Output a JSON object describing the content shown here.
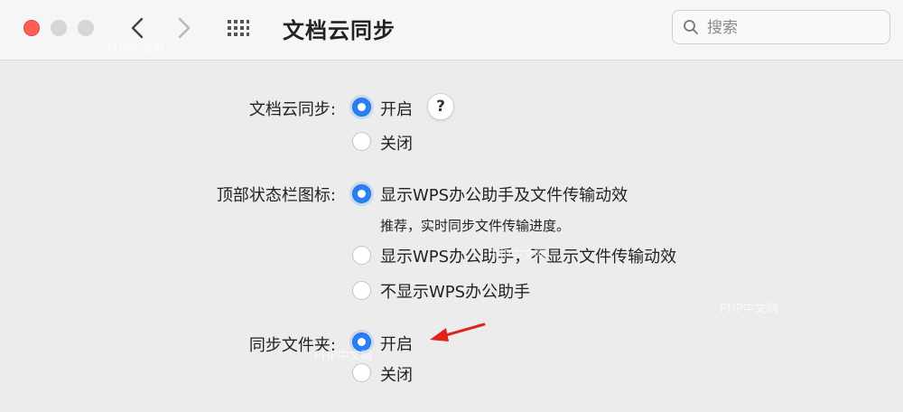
{
  "window": {
    "title": "文档云同步"
  },
  "search": {
    "placeholder": "搜索"
  },
  "settings": {
    "cloud_sync": {
      "label": "文档云同步:",
      "options": [
        "开启",
        "关闭"
      ],
      "selected": "开启",
      "help": "?"
    },
    "status_bar_icon": {
      "label": "顶部状态栏图标:",
      "options": [
        "显示WPS办公助手及文件传输动效",
        "显示WPS办公助手，不显示文件传输动效",
        "不显示WPS办公助手"
      ],
      "description": "推荐，实时同步文件传输进度。",
      "selected": "显示WPS办公助手及文件传输动效"
    },
    "sync_folder": {
      "label": "同步文件夹:",
      "options": [
        "开启",
        "关闭"
      ],
      "selected": "开启"
    }
  },
  "watermarks": [
    "PHP中文网",
    "PHP中文网",
    "PHP中文网",
    "PHP中文网"
  ],
  "colors": {
    "accent": "#2b7ff5",
    "annotation": "#e0231c",
    "close": "#fe5f57"
  }
}
